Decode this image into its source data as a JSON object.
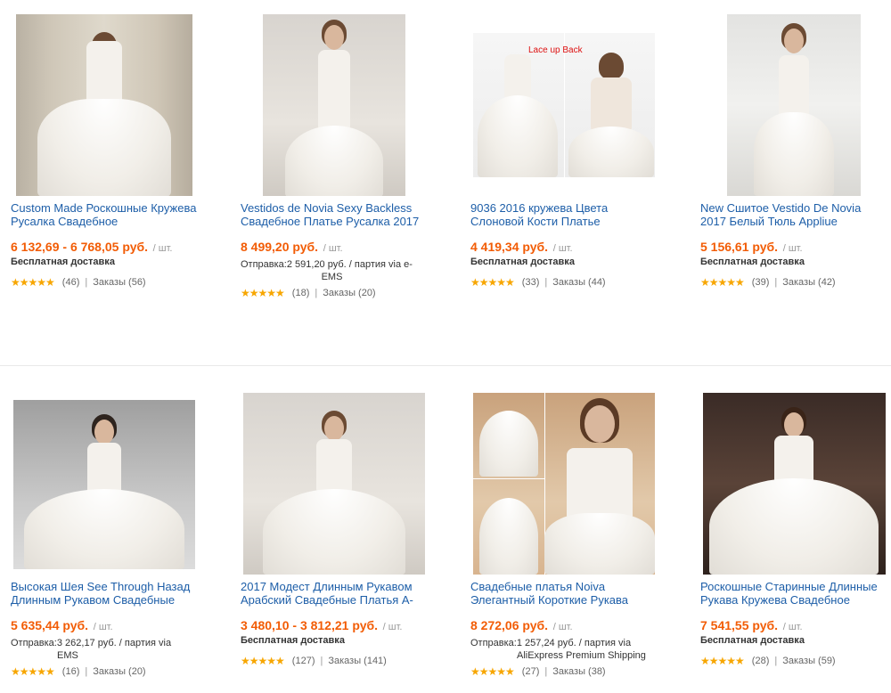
{
  "products": [
    {
      "title": "Custom Made Роскошные Кружева Русалка Свадебное",
      "price": "6 132,69 - 6 768,05 руб.",
      "unit": "/ шт.",
      "shipping_line1": "Бесплатная доставка",
      "shipping_line2": "",
      "stars": "★★★★★",
      "reviews": "(46)",
      "orders": "Заказы (56)",
      "image_icon": "wedding-dress-photo"
    },
    {
      "title": "Vestidos de Novia Sexy Backless Свадебное Платье Русалка 2017",
      "price": "8 499,20 руб.",
      "unit": "/ шт.",
      "shipping_line1": "Отправка:2 591,20 руб. / партия via e-",
      "shipping_line2": "EMS",
      "stars": "★★★★★",
      "reviews": "(18)",
      "orders": "Заказы (20)",
      "image_icon": "wedding-dress-photo"
    },
    {
      "title": "9036 2016 кружева Цвета Слоновой Кости Платье",
      "price": "4 419,34 руб.",
      "unit": "/ шт.",
      "shipping_line1": "Бесплатная доставка",
      "shipping_line2": "",
      "stars": "★★★★★",
      "reviews": "(33)",
      "orders": "Заказы (44)",
      "image_label": "Lace up Back",
      "image_icon": "wedding-dress-photo"
    },
    {
      "title": "New Сшитое Vestido De Novia 2017 Белый Тюль Appliue",
      "price": "5 156,61 руб.",
      "unit": "/ шт.",
      "shipping_line1": "Бесплатная доставка",
      "shipping_line2": "",
      "stars": "★★★★★",
      "reviews": "(39)",
      "orders": "Заказы (42)",
      "image_icon": "wedding-dress-photo"
    },
    {
      "title": "Высокая Шея See Through Назад Длинным Рукавом Свадебные",
      "price": "5 635,44 руб.",
      "unit": "/ шт.",
      "shipping_line1": "Отправка:3 262,17 руб. / партия via",
      "shipping_line2": "EMS",
      "stars": "★★★★★",
      "reviews": "(16)",
      "orders": "Заказы (20)",
      "image_icon": "wedding-dress-photo"
    },
    {
      "title": "2017 Модест Длинным Рукавом Арабский Свадебные Платья А-",
      "price": "3 480,10 - 3 812,21 руб.",
      "unit": "/ шт.",
      "shipping_line1": "Бесплатная доставка",
      "shipping_line2": "",
      "stars": "★★★★★",
      "reviews": "(127)",
      "orders": "Заказы (141)",
      "image_icon": "wedding-dress-photo"
    },
    {
      "title": "Свадебные платья Noiva Элегантный Короткие Рукава",
      "price": "8 272,06 руб.",
      "unit": "/ шт.",
      "shipping_line1": "Отправка:1 257,24 руб. / партия via",
      "shipping_line2": "AliExpress Premium Shipping",
      "stars": "★★★★★",
      "reviews": "(27)",
      "orders": "Заказы (38)",
      "image_icon": "wedding-dress-photo"
    },
    {
      "title": "Роскошные Старинные Длинные Рукава Кружева Свадебное",
      "price": "7 541,55 руб.",
      "unit": "/ шт.",
      "shipping_line1": "Бесплатная доставка",
      "shipping_line2": "",
      "stars": "★★★★★",
      "reviews": "(28)",
      "orders": "Заказы (59)",
      "image_icon": "wedding-dress-photo"
    }
  ],
  "rating_separator": "|",
  "colors": {
    "link": "#1d5ea8",
    "price": "#f25c05",
    "star": "#f7a600"
  }
}
